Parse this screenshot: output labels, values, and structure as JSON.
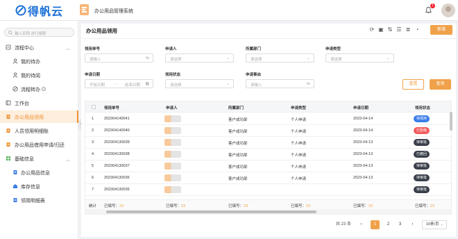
{
  "header": {
    "logo_text": "得帆云",
    "system_title": "办公用品管理系统",
    "notification_count": "1",
    "accent": "#f0a24a"
  },
  "sidebar": {
    "search_placeholder": "输入名称 进行搜索",
    "items": [
      {
        "label": "流程中心",
        "icon": "flow-icon",
        "type": "group"
      },
      {
        "label": "我的待办",
        "icon": "person-icon",
        "type": "sub"
      },
      {
        "label": "我的待阅",
        "icon": "person-icon",
        "type": "sub"
      },
      {
        "label": "流程转办",
        "icon": "transfer-icon",
        "type": "sub"
      },
      {
        "label": "工作台",
        "icon": "workbench-icon",
        "type": "top"
      },
      {
        "label": "办公用品领用",
        "icon": "document-icon",
        "type": "top",
        "active": true
      },
      {
        "label": "人员领用明细账",
        "icon": "document-icon",
        "type": "top"
      },
      {
        "label": "办公用品借用申请/归还",
        "icon": "document-icon",
        "type": "top"
      },
      {
        "label": "基础信息",
        "icon": "grid-icon",
        "type": "group"
      },
      {
        "label": "办公用品信息",
        "icon": "document-icon",
        "type": "sub"
      },
      {
        "label": "库存信息",
        "icon": "warehouse-icon",
        "type": "sub"
      },
      {
        "label": "领用明细表",
        "icon": "document-icon",
        "type": "sub"
      }
    ]
  },
  "page": {
    "title": "办公用品领用",
    "new_button": "新增",
    "reset_button": "重置",
    "query_button": "查询"
  },
  "filters": {
    "order_no": {
      "label": "领用单号",
      "placeholder": "请输入"
    },
    "applicant": {
      "label": "申请人",
      "placeholder": "请选择"
    },
    "department": {
      "label": "所属部门",
      "placeholder": "请选择"
    },
    "apply_type": {
      "label": "申请类型",
      "placeholder": "请选择"
    },
    "apply_date": {
      "label": "申请日期",
      "start_placeholder": "开始日期",
      "separator": "-",
      "end_placeholder": "结束日期"
    },
    "status": {
      "label": "领用状态",
      "placeholder": "请选择"
    },
    "reason": {
      "label": "申请事由",
      "placeholder": "请输入"
    }
  },
  "table": {
    "columns": [
      "领用单号",
      "申请人",
      "所属部门",
      "申请类型",
      "申请日期",
      "领用状态"
    ],
    "rows": [
      {
        "index": "1",
        "order_no": "202304140041",
        "department": "客户成功部",
        "type": "个人申请",
        "date": "2023-04-14",
        "status": "待领用",
        "status_color": "#3b7de8"
      },
      {
        "index": "2",
        "order_no": "202304140040",
        "department": "客户成功部",
        "type": "个人申请",
        "date": "2023-04-14",
        "status": "已拒绝",
        "status_color": "#f25c5c"
      },
      {
        "index": "3",
        "order_no": "202304130039",
        "department": "客户成功部",
        "type": "个人申请",
        "date": "2023-04-13",
        "status": "待审批",
        "status_color": "#3a3f4a"
      },
      {
        "index": "4",
        "order_no": "202304130038",
        "department": "客户成功部",
        "type": "个人申请",
        "date": "2023-04-13",
        "status": "已撤回",
        "status_color": "#3a3f4a"
      },
      {
        "index": "5",
        "order_no": "202304130037",
        "department": "客户成功部",
        "type": "个人申请",
        "date": "2023-04-13",
        "status": "待审批",
        "status_color": "#3a3f4a"
      },
      {
        "index": "6",
        "order_no": "202304130036",
        "department": "客户成功部",
        "type": "个人申请",
        "date": "2023-04-13",
        "status": "待审批",
        "status_color": "#3a3f4a"
      },
      {
        "index": "7",
        "order_no": "202304130035",
        "department": "",
        "type": "",
        "date": "",
        "status": "待审批",
        "status_color": "#3a3f4a"
      }
    ],
    "summary": {
      "label": "统计",
      "filled_label": "已填写：",
      "filled_count": "23"
    }
  },
  "pagination": {
    "total": "共 23 条",
    "pages": [
      "1",
      "2",
      "3"
    ],
    "current": "1",
    "page_size": "10条/页",
    "prev": "‹",
    "next": "›"
  }
}
